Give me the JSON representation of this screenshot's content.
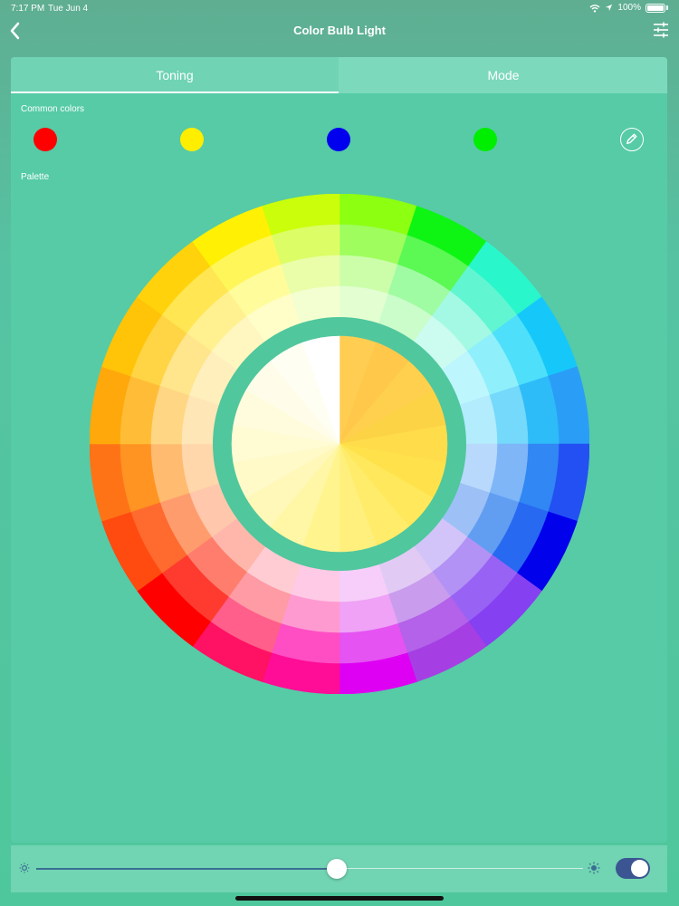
{
  "status": {
    "time": "7:17 PM",
    "date": "Tue Jun 4",
    "battery": "100%"
  },
  "nav": {
    "title": "Color Bulb Light",
    "back_icon": "chevron-left-icon",
    "settings_icon": "sliders-icon"
  },
  "tabs": [
    {
      "label": "Toning",
      "active": true
    },
    {
      "label": "Mode",
      "active": false
    }
  ],
  "common_colors": {
    "label": "Common colors",
    "swatches": [
      "#ff0000",
      "#ffee00",
      "#0000ee",
      "#00ee00"
    ],
    "edit_icon": "pencil-icon"
  },
  "palette": {
    "label": "Palette",
    "outer_ring": [
      "#8dff11",
      "#0ef513",
      "#29f7cb",
      "#16c8f9",
      "#2a9ef7",
      "#2350f3",
      "#0201ec",
      "#8540f1",
      "#a53fe4",
      "#de00f3",
      "#ff0d96",
      "#ff1163",
      "#ff0000",
      "#ff4a10",
      "#ff7317",
      "#ffa80c",
      "#ffc307",
      "#ffd20c",
      "#fff004",
      "#cafe0a"
    ],
    "middle_ring": [
      "#9ffd5e",
      "#5cf854",
      "#61f6d1",
      "#4ee0fb",
      "#2ebcf9",
      "#3187f4",
      "#2869f1",
      "#9863f4",
      "#b362e9",
      "#e553f2",
      "#ff4ec3",
      "#ff5f8a",
      "#ff3a2f",
      "#ff6a2e",
      "#ff9422",
      "#ffbd37",
      "#ffd445",
      "#ffe652",
      "#fff759",
      "#dcfd66"
    ],
    "inner_ring": [
      "#ccfeaa",
      "#9ffca2",
      "#a4f9e4",
      "#8ff0fb",
      "#74d9fa",
      "#7eb6f8",
      "#619ef2",
      "#b292f5",
      "#c99cee",
      "#efa2f6",
      "#ff9ad1",
      "#ff9ba5",
      "#ff7d6c",
      "#ff9c6e",
      "#ffbb70",
      "#ffd683",
      "#ffe58b",
      "#fff190",
      "#fffc9c",
      "#eafea9"
    ],
    "inner_most_ring": [
      "#e3ffd2",
      "#cbfdcb",
      "#cbfcef",
      "#bef6fd",
      "#b3ecfd",
      "#b8d9fc",
      "#9dc0f6",
      "#d2c4f8",
      "#e1cbf4",
      "#f6cef9",
      "#ffcae6",
      "#ffccd3",
      "#ffb7ab",
      "#ffc7ab",
      "#ffd7ab",
      "#ffe6b6",
      "#ffefbd",
      "#fff6c0",
      "#fffec8",
      "#f3ffd0"
    ],
    "center_disc": [
      "#fecd51",
      "#ffc84a",
      "#ffd04d",
      "#fdd346",
      "#ffdc4a",
      "#ffe24b",
      "#ffe85b",
      "#ffec6a",
      "#fff07e",
      "#fff48e",
      "#fff7a5",
      "#fff8b8",
      "#fffac8",
      "#fffbd2",
      "#fffcdd",
      "#fffde9",
      "#fffef3",
      "#ffffff"
    ],
    "center_ring_color": "#50c79d"
  },
  "brightness": {
    "value": 55,
    "min_icon": "sun-small-icon",
    "max_icon": "sun-large-icon"
  },
  "power_toggle": {
    "on": true,
    "color": "#3b5592"
  }
}
